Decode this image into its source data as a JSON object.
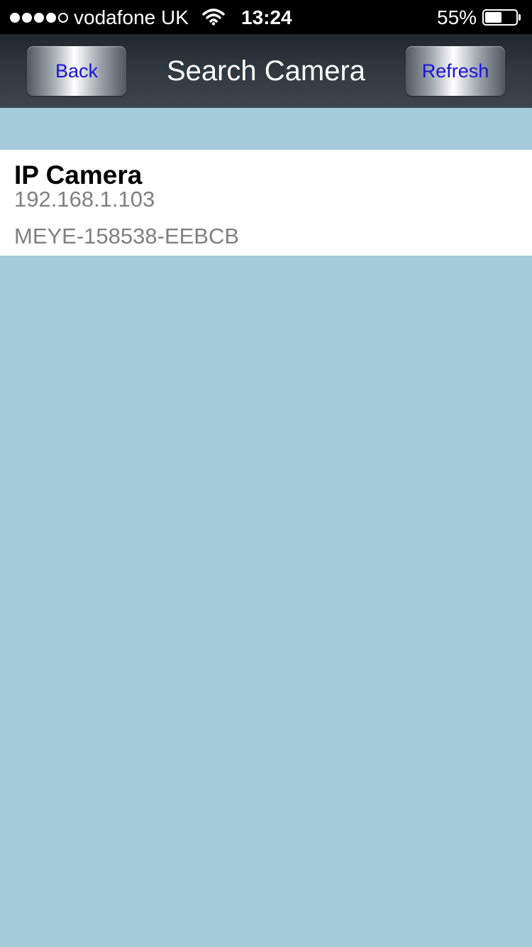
{
  "status_bar": {
    "signal_bars_filled": 4,
    "signal_bars_total": 5,
    "carrier": "vodafone UK",
    "time": "13:24",
    "battery_percent": "55%",
    "battery_level": 0.55
  },
  "nav": {
    "back_label": "Back",
    "title": "Search Camera",
    "refresh_label": "Refresh"
  },
  "cameras": [
    {
      "name": "IP Camera",
      "ip": "192.168.1.103",
      "uid": "MEYE-158538-EEBCB"
    }
  ],
  "colors": {
    "background": "#a3cbd9",
    "button_text": "#1a12d6",
    "secondary_text": "#808080"
  }
}
